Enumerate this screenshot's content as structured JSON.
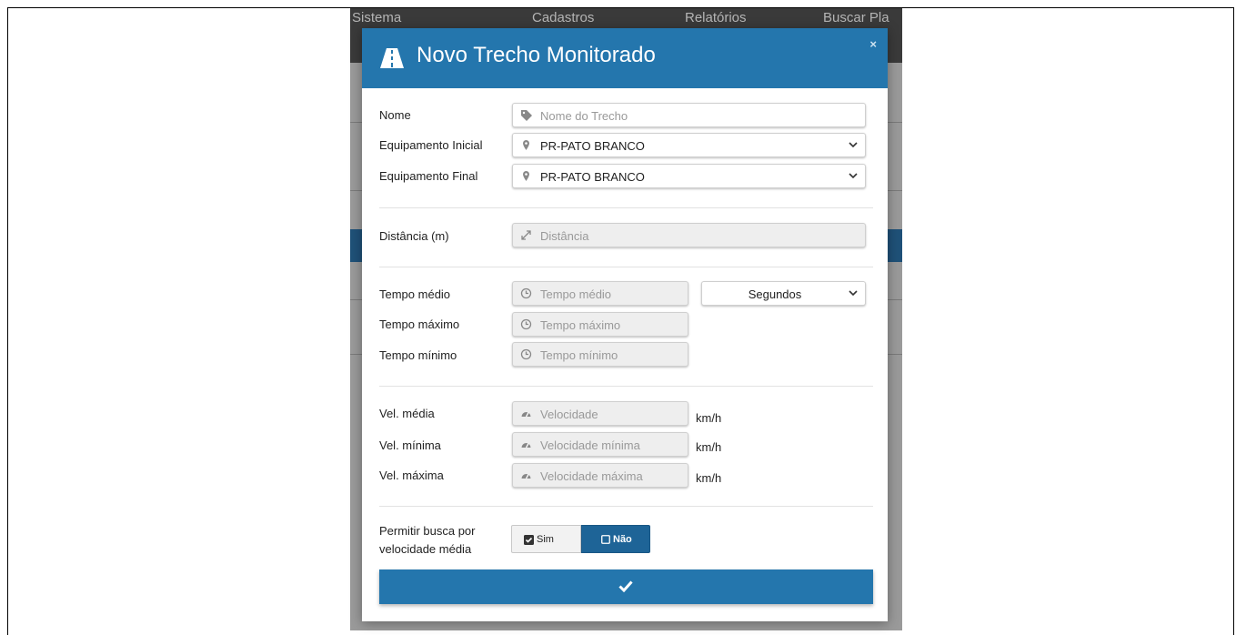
{
  "background": {
    "nav_items": [
      "Sistema",
      "Cadastros",
      "Relatórios",
      "Buscar Pla"
    ]
  },
  "modal": {
    "title": "Novo Trecho Monitorado",
    "close": "×",
    "nome": {
      "label": "Nome",
      "placeholder": "Nome do Trecho",
      "icon": "tag-icon"
    },
    "equip_inicial": {
      "label": "Equipamento Inicial",
      "value": "PR-PATO BRANCO",
      "icon": "map-marker-icon"
    },
    "equip_final": {
      "label": "Equipamento Final",
      "value": "PR-PATO BRANCO",
      "icon": "map-marker-icon"
    },
    "distancia": {
      "label": "Distância (m)",
      "placeholder": "Distância",
      "icon": "expand-arrows-icon"
    },
    "tempo_medio": {
      "label": "Tempo médio",
      "placeholder": "Tempo médio",
      "icon": "clock-icon"
    },
    "tempo_unidade": {
      "value": "Segundos"
    },
    "tempo_maximo": {
      "label": "Tempo máximo",
      "placeholder": "Tempo máximo",
      "icon": "clock-icon"
    },
    "tempo_minimo": {
      "label": "Tempo mínimo",
      "placeholder": "Tempo mínimo",
      "icon": "clock-icon"
    },
    "vel_media": {
      "label": "Vel. média",
      "placeholder": "Velocidade",
      "unit": "km/h",
      "icon": "speedometer-icon"
    },
    "vel_minima": {
      "label": "Vel. mínima",
      "placeholder": "Velocidade mínima",
      "unit": "km/h",
      "icon": "speedometer-icon"
    },
    "vel_maxima": {
      "label": "Vel. máxima",
      "placeholder": "Velocidade máxima",
      "unit": "km/h",
      "icon": "speedometer-icon"
    },
    "permitir": {
      "label_line1": "Permitir busca por",
      "label_line2": "velocidade média",
      "sim_label": "Sim",
      "nao_label": "Não",
      "selected": "Não"
    },
    "submit_icon": "check-icon"
  },
  "colors": {
    "header": "#2476ad",
    "toggle_active": "#1e6497",
    "submit": "#2476ad"
  }
}
